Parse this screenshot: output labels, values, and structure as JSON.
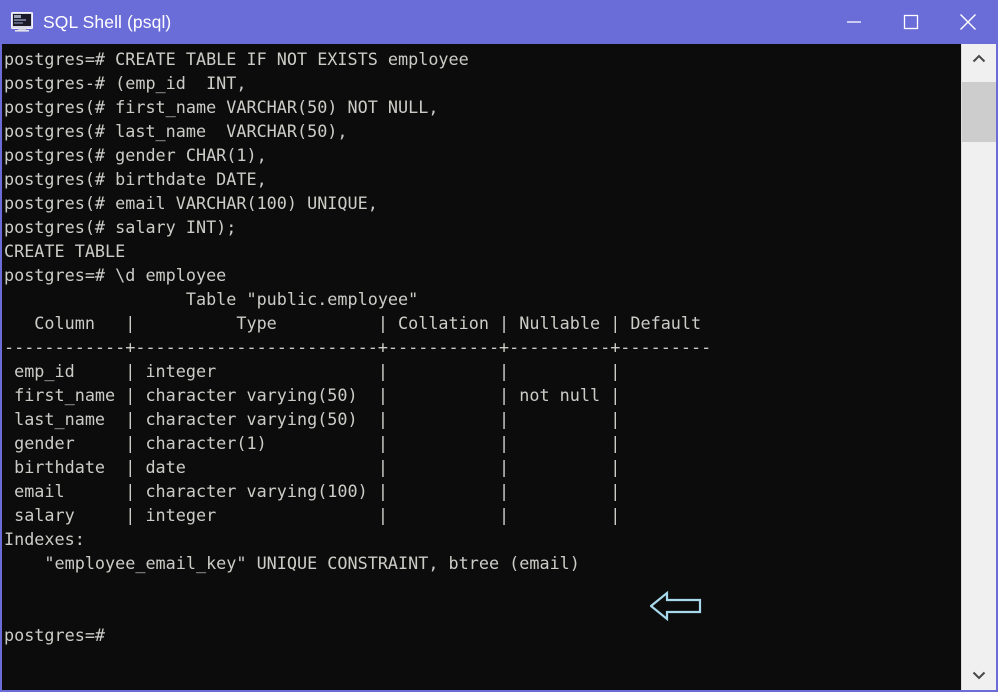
{
  "window": {
    "title": "SQL Shell (psql)",
    "icon": "terminal-monitor-icon",
    "titlebar_color": "#6a6cd8",
    "background_color": "#0c0c0c",
    "text_color": "#ccccc7"
  },
  "window_controls": {
    "minimize": "—",
    "maximize": "□",
    "close": "✕"
  },
  "terminal": {
    "prompt_primary": "postgres=#",
    "prompt_continuation_dash": "postgres-#",
    "prompt_continuation_paren": "postgres(#",
    "content": "postgres=# CREATE TABLE IF NOT EXISTS employee\npostgres-# (emp_id  INT,\npostgres(# first_name VARCHAR(50) NOT NULL,\npostgres(# last_name  VARCHAR(50),\npostgres(# gender CHAR(1),\npostgres(# birthdate DATE,\npostgres(# email VARCHAR(100) UNIQUE,\npostgres(# salary INT);\nCREATE TABLE\npostgres=# \\d employee\n                  Table \"public.employee\"\n   Column   |          Type          | Collation | Nullable | Default\n------------+------------------------+-----------+----------+---------\n emp_id     | integer                |           |          |\n first_name | character varying(50)  |           | not null |\n last_name  | character varying(50)  |           |          |\n gender     | character(1)           |           |          |\n birthdate  | date                   |           |          |\n email      | character varying(100) |           |          |\n salary     | integer                |           |          |\nIndexes:\n    \"employee_email_key\" UNIQUE CONSTRAINT, btree (email)\n\n\npostgres=#",
    "commands": [
      {
        "prompt": "postgres=#",
        "text": "CREATE TABLE IF NOT EXISTS employee"
      },
      {
        "prompt": "postgres-#",
        "text": "(emp_id  INT,"
      },
      {
        "prompt": "postgres(#",
        "text": "first_name VARCHAR(50) NOT NULL,"
      },
      {
        "prompt": "postgres(#",
        "text": "last_name  VARCHAR(50),"
      },
      {
        "prompt": "postgres(#",
        "text": "gender CHAR(1),"
      },
      {
        "prompt": "postgres(#",
        "text": "birthdate DATE,"
      },
      {
        "prompt": "postgres(#",
        "text": "email VARCHAR(100) UNIQUE,"
      },
      {
        "prompt": "postgres(#",
        "text": "salary INT);"
      }
    ],
    "result_message": "CREATE TABLE",
    "describe_command": "\\d employee",
    "table_caption": "Table \"public.employee\"",
    "table_headers": [
      "Column",
      "Type",
      "Collation",
      "Nullable",
      "Default"
    ],
    "table_rows": [
      {
        "column": "emp_id",
        "type": "integer",
        "collation": "",
        "nullable": "",
        "default": ""
      },
      {
        "column": "first_name",
        "type": "character varying(50)",
        "collation": "",
        "nullable": "not null",
        "default": ""
      },
      {
        "column": "last_name",
        "type": "character varying(50)",
        "collation": "",
        "nullable": "",
        "default": ""
      },
      {
        "column": "gender",
        "type": "character(1)",
        "collation": "",
        "nullable": "",
        "default": ""
      },
      {
        "column": "birthdate",
        "type": "date",
        "collation": "",
        "nullable": "",
        "default": ""
      },
      {
        "column": "email",
        "type": "character varying(100)",
        "collation": "",
        "nullable": "",
        "default": ""
      },
      {
        "column": "salary",
        "type": "integer",
        "collation": "",
        "nullable": "",
        "default": ""
      }
    ],
    "indexes_label": "Indexes:",
    "indexes": [
      "\"employee_email_key\" UNIQUE CONSTRAINT, btree (email)"
    ],
    "final_prompt": "postgres=#"
  },
  "annotation": {
    "shape": "left-arrow",
    "color": "#a8d8ec",
    "points_to": "\"employee_email_key\" UNIQUE CONSTRAINT, btree (email)"
  },
  "scrollbar": {
    "up_arrow": "⌃",
    "down_arrow": "⌄",
    "orientation": "vertical"
  }
}
